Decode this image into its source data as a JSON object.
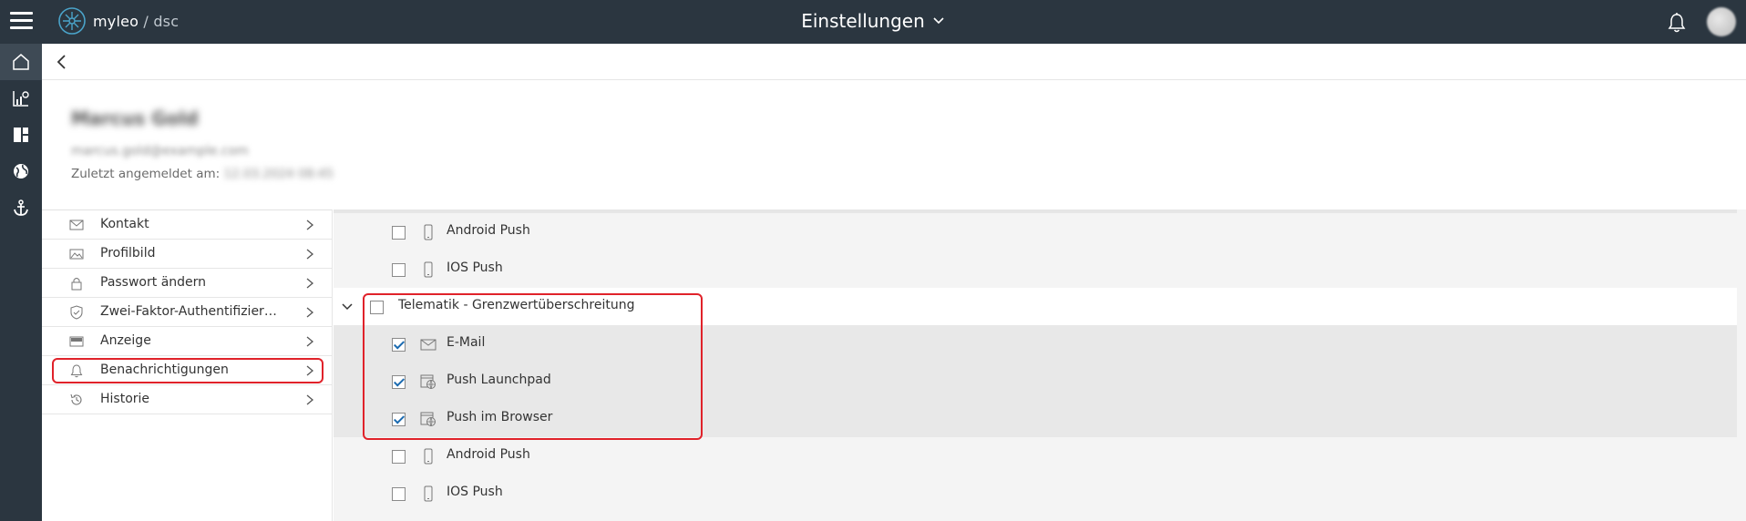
{
  "app": {
    "logo_name": "myleo",
    "logo_separator": " / ",
    "logo_suffix": "dsc",
    "page_title": "Einstellungen"
  },
  "rail": {
    "items": [
      {
        "icon": "home-icon",
        "active": true
      },
      {
        "icon": "analytics-icon",
        "active": false
      },
      {
        "icon": "dashboard-icon",
        "active": false
      },
      {
        "icon": "globe-icon",
        "active": false
      },
      {
        "icon": "anchor-icon",
        "active": false
      }
    ]
  },
  "profile": {
    "name": "Marcus Gold",
    "email": "marcus.gold@example.com",
    "last_login_label": "Zuletzt angemeldet am:",
    "last_login_value": "12.03.2024 08:45"
  },
  "menu": {
    "items": [
      {
        "label": "Kontakt",
        "icon": "envelope-icon"
      },
      {
        "label": "Profilbild",
        "icon": "image-icon"
      },
      {
        "label": "Passwort ändern",
        "icon": "lock-icon"
      },
      {
        "label": "Zwei-Faktor-Authentifizierung",
        "icon": "shield-icon"
      },
      {
        "label": "Anzeige",
        "icon": "display-icon"
      },
      {
        "label": "Benachrichtigungen",
        "icon": "bell-icon",
        "selected": true
      },
      {
        "label": "Historie",
        "icon": "history-icon"
      }
    ]
  },
  "notifications": {
    "rows": [
      {
        "label": "Android Push",
        "icon": "phone-icon",
        "checked": false,
        "level": "child"
      },
      {
        "label": "IOS Push",
        "icon": "phone-icon",
        "checked": false,
        "level": "child"
      },
      {
        "label": "Telematik - Grenzwertüberschreitung",
        "checked": false,
        "level": "group",
        "expanded": true
      },
      {
        "label": "E-Mail",
        "icon": "envelope-icon",
        "checked": true,
        "level": "child"
      },
      {
        "label": "Push Launchpad",
        "icon": "web-push-icon",
        "checked": true,
        "level": "child"
      },
      {
        "label": "Push im Browser",
        "icon": "web-push-icon",
        "checked": true,
        "level": "child"
      },
      {
        "label": "Android Push",
        "icon": "phone-icon",
        "checked": false,
        "level": "child"
      },
      {
        "label": "IOS Push",
        "icon": "phone-icon",
        "checked": false,
        "level": "child"
      }
    ]
  },
  "colors": {
    "topbar": "#2b3640",
    "highlight": "#e0222a",
    "check": "#1a6ab0"
  }
}
